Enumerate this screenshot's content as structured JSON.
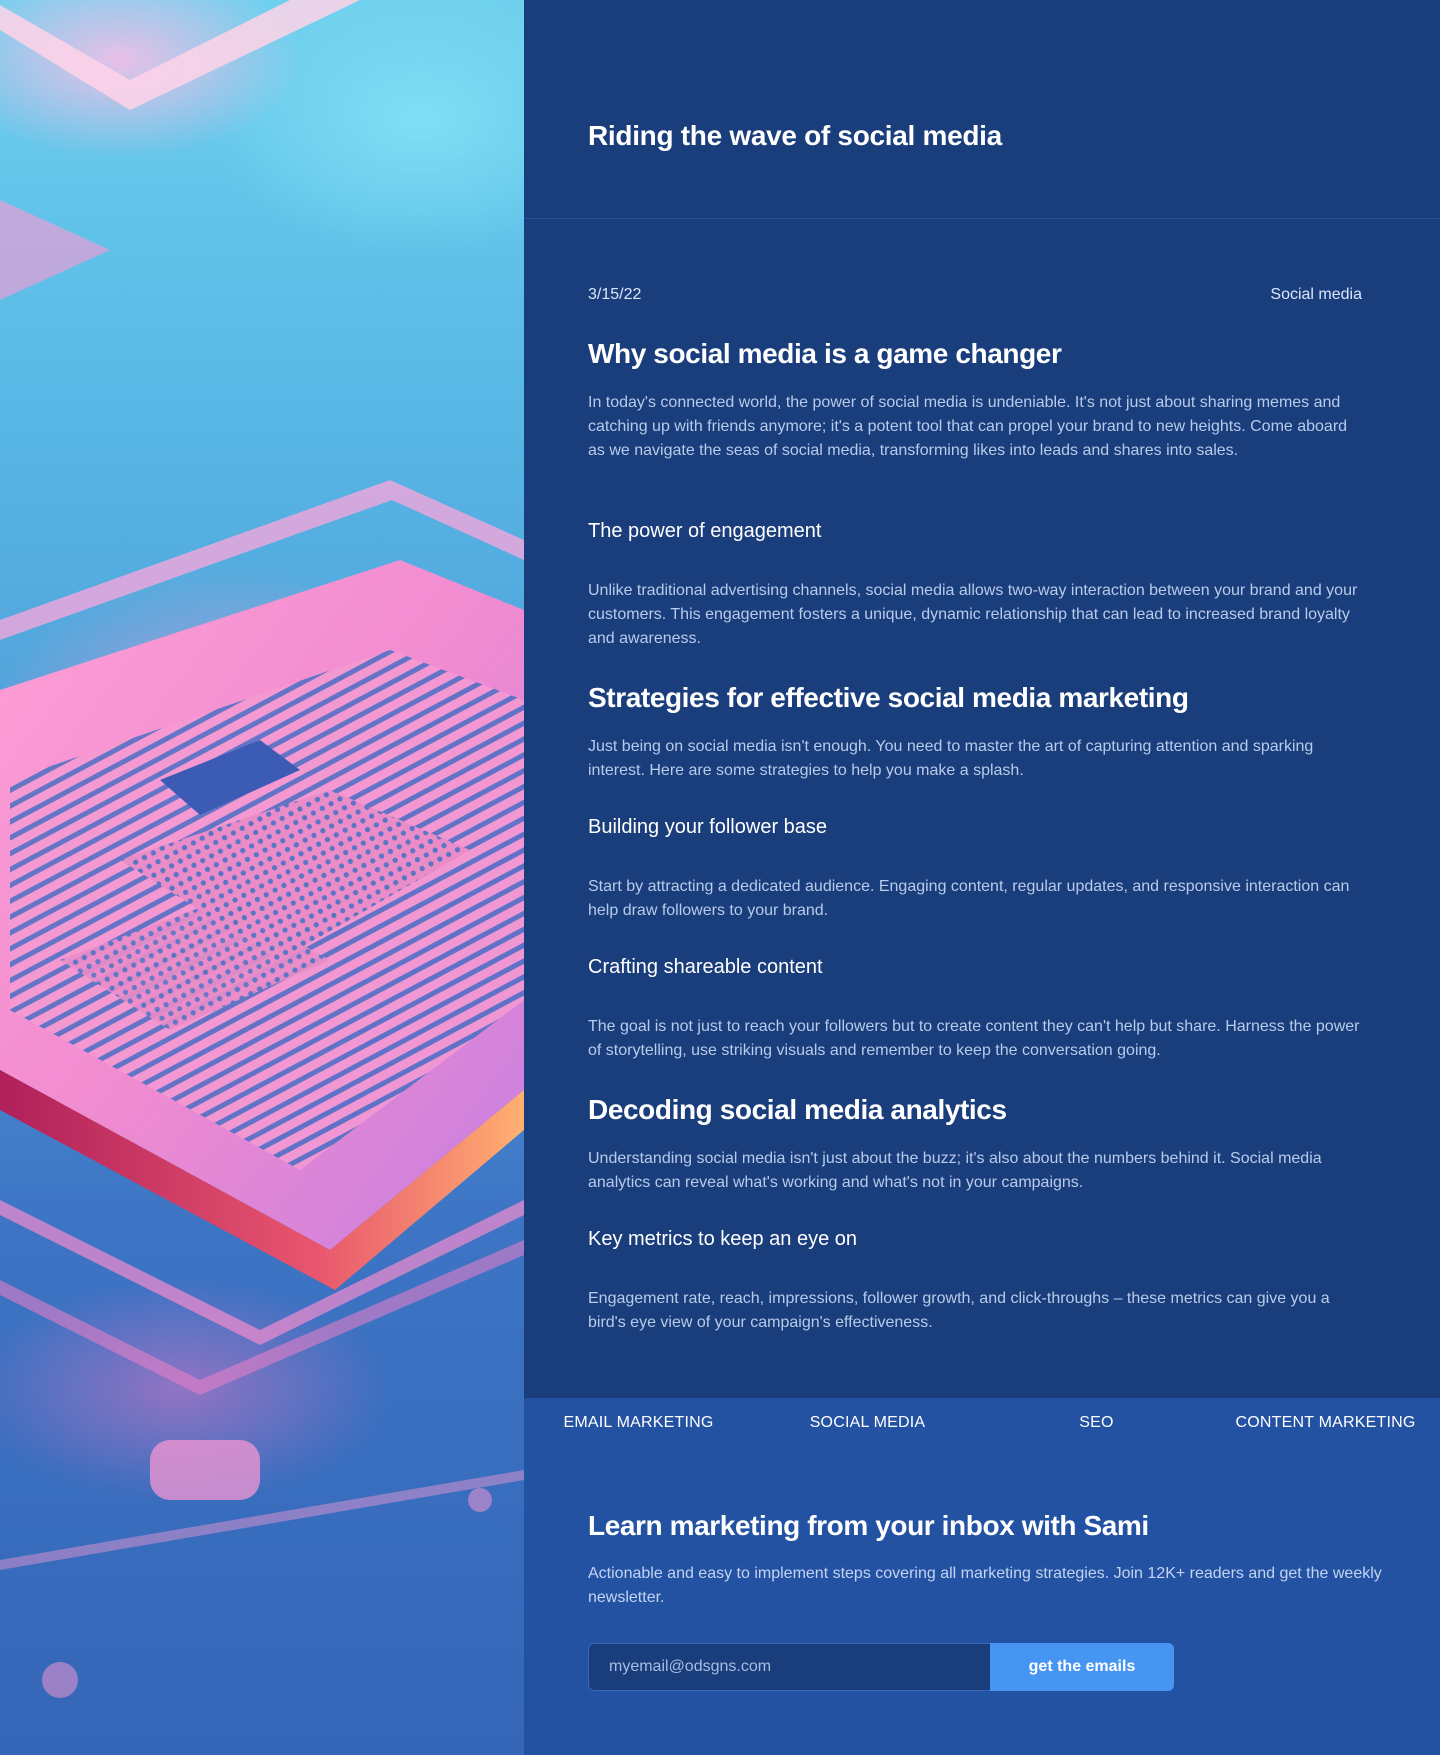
{
  "site": {
    "title": "Riding the wave of social media"
  },
  "post": {
    "date": "3/15/22",
    "category": "Social media",
    "sections": [
      {
        "heading": "Why social media is a game changer",
        "text": "In today's connected world, the power of social media is undeniable. It's not just about sharing memes and catching up with friends anymore; it's a potent tool that can propel your brand to new heights. Come aboard as we navigate the seas of social media, transforming likes into leads and shares into sales."
      },
      {
        "heading": "The power of engagement",
        "text": "Unlike traditional advertising channels, social media allows two-way interaction between your brand and your customers. This engagement fosters a unique, dynamic relationship that can lead to increased brand loyalty and awareness."
      },
      {
        "heading": "Strategies for effective social media marketing",
        "text": "Just being on social media isn't enough. You need to master the art of capturing attention and sparking interest. Here are some strategies to help you make a splash."
      },
      {
        "heading": "Building your follower base",
        "text": "Start by attracting a dedicated audience. Engaging content, regular updates, and responsive interaction can help draw followers to your brand."
      },
      {
        "heading": "Crafting shareable content",
        "text": "The goal is not just to reach your followers but to create content they can't help but share. Harness the power of storytelling, use striking visuals and remember to keep the conversation going."
      },
      {
        "heading": "Decoding social media analytics",
        "text": "Understanding social media isn't just about the buzz; it's also about the numbers behind it. Social media analytics can reveal what's working and what's not in your campaigns."
      },
      {
        "heading": "Key metrics to keep an eye on",
        "text": "Engagement rate, reach, impressions, follower growth, and click-throughs – these metrics can give you a bird's eye view of your campaign's effectiveness."
      }
    ]
  },
  "categories": [
    "EMAIL MARKETING",
    "SOCIAL MEDIA",
    "SEO",
    "CONTENT MARKETING"
  ],
  "newsletter": {
    "title": "Learn marketing from your inbox with Sami",
    "text": "Actionable and easy to implement steps covering all marketing strategies. Join 12K+ readers and get the weekly newsletter.",
    "placeholder": "myemail@odsgns.com",
    "button": "get the emails"
  },
  "colors": {
    "background": "#1a3d7c",
    "band": "#2452a3",
    "accent": "#4795f2"
  }
}
